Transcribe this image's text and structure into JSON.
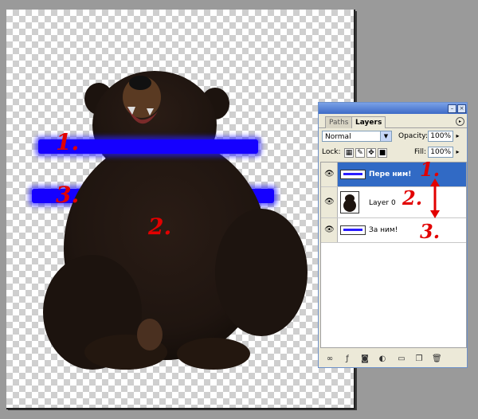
{
  "annotations": {
    "left": [
      "1.",
      "3.",
      "2."
    ],
    "panel": [
      "1.",
      "2.",
      "3."
    ]
  },
  "panel": {
    "tabs": [
      "Paths",
      "Layers"
    ],
    "blend_mode": "Normal",
    "opacity_label": "Opacity:",
    "opacity_value": "100%",
    "lock_label": "Lock:",
    "fill_label": "Fill:",
    "fill_value": "100%",
    "layers": [
      {
        "name": "Пере ним!",
        "selected": true,
        "visible": true,
        "thumbnail": "blue-stroke"
      },
      {
        "name": "Layer 0",
        "selected": false,
        "visible": true,
        "thumbnail": "bear"
      },
      {
        "name": "За ним!",
        "selected": false,
        "visible": true,
        "thumbnail": "blue-stroke"
      }
    ]
  },
  "colors": {
    "stroke": "#1500ff",
    "annotation": "#e20000",
    "selection": "#316ac5"
  }
}
